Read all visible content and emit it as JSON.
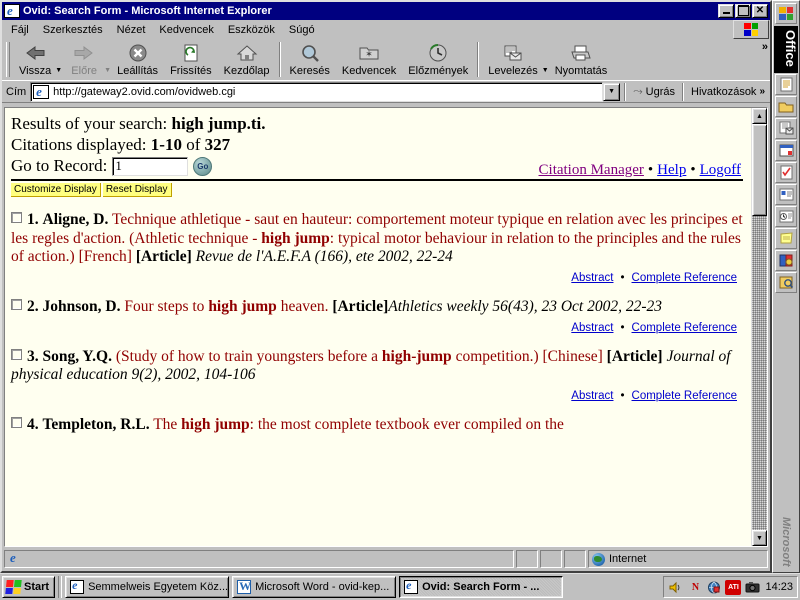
{
  "window": {
    "title": "Ovid: Search Form - Microsoft Internet Explorer",
    "minimize_label": "Minimize",
    "restore_label": "Restore",
    "close_label": "Close"
  },
  "menubar": {
    "items": [
      {
        "label": "Fájl"
      },
      {
        "label": "Szerkesztés"
      },
      {
        "label": "Nézet"
      },
      {
        "label": "Kedvencek"
      },
      {
        "label": "Eszközök"
      },
      {
        "label": "Súgó"
      }
    ]
  },
  "toolbar": {
    "back": "Vissza",
    "forward": "Előre",
    "stop": "Leállítás",
    "refresh": "Frissítés",
    "home": "Kezdőlap",
    "search": "Keresés",
    "favorites": "Kedvencek",
    "history": "Előzmények",
    "mail": "Levelezés",
    "print": "Nyomtatás",
    "overflow": "»"
  },
  "address": {
    "label": "Cím",
    "url": "http://gateway2.ovid.com/ovidweb.cgi",
    "go": "Ugrás",
    "links": "Hivatkozások",
    "links_overflow": "»"
  },
  "page": {
    "results_label": "Results of your search:",
    "results_query": "high jump.ti.",
    "citations_label": "Citations displayed:",
    "citations_range": "1-10",
    "citations_of": "of",
    "citations_total": "327",
    "goto_label": "Go to Record:",
    "goto_value": "1",
    "go_button": "Go",
    "top_links": [
      {
        "label": "Citation Manager",
        "state": "visited"
      },
      {
        "label": "Help",
        "state": "link"
      },
      {
        "label": "Logoff",
        "state": "link"
      }
    ],
    "separator": "•",
    "display_buttons": [
      {
        "label": "Customize Display"
      },
      {
        "label": "Reset Display"
      }
    ],
    "abstract_label": "Abstract",
    "complete_reference_label": "Complete Reference",
    "citations": [
      {
        "number": "1.",
        "author": "Aligne, D.",
        "title_pre": "Technique athletique - saut en hauteur: comportement moteur typique en relation avec les principes et les regles d'action. (Athletic technique - ",
        "title_bold": "high jump",
        "title_post": ": typical motor behaviour in relation to the principles and the rules of action.)",
        "language": "[French]",
        "doctype": "[Article]",
        "source": "Revue de l'A.E.F.A (166), ete 2002, 22-24"
      },
      {
        "number": "2.",
        "author": "Johnson, D.",
        "title_pre": "Four steps to ",
        "title_bold": "high jump",
        "title_post": " heaven.",
        "language": "",
        "doctype": "[Article]",
        "source": "Athletics weekly 56(43), 23 Oct 2002, 22-23"
      },
      {
        "number": "3.",
        "author": "Song, Y.Q.",
        "title_pre": "(Study of how to train youngsters before a ",
        "title_bold": "high-jump",
        "title_post": " competition.)",
        "language": "[Chinese]",
        "doctype": "[Article]",
        "source": "Journal of physical education 9(2), 2002, 104-106"
      },
      {
        "number": "4.",
        "author": "Templeton, R.L.",
        "title_pre": "The ",
        "title_bold": "high jump",
        "title_post": ": the most complete textbook ever compiled on the",
        "language": "",
        "doctype": "",
        "source": ""
      }
    ]
  },
  "statusbar": {
    "message": "",
    "zone": "Internet"
  },
  "officebar": {
    "title": "Office",
    "footer": "Microsoft",
    "icons": [
      "office-logo-icon",
      "new-document-icon",
      "open-document-icon",
      "new-message-icon",
      "new-appointment-icon",
      "new-task-icon",
      "new-contact-icon",
      "new-journal-icon",
      "new-note-icon",
      "getting-results-book-icon",
      "answer-wizard-icon"
    ]
  },
  "taskbar": {
    "start_label": "Start",
    "items": [
      {
        "label": "Semmelweis Egyetem Köz...",
        "icon": "ie-icon",
        "active": false
      },
      {
        "label": "Microsoft Word - ovid-kep...",
        "icon": "word-icon",
        "active": false
      },
      {
        "label": "Ovid: Search Form - ...",
        "icon": "ie-icon",
        "active": true
      }
    ],
    "tray": [
      {
        "name": "volume-icon",
        "glyph": "🔊"
      },
      {
        "name": "norton-icon",
        "glyph": "N"
      },
      {
        "name": "network-icon",
        "glyph": "⊕"
      },
      {
        "name": "ati-icon",
        "glyph": "ATI"
      },
      {
        "name": "camera-icon",
        "glyph": "▭"
      }
    ],
    "clock": "14:23"
  }
}
